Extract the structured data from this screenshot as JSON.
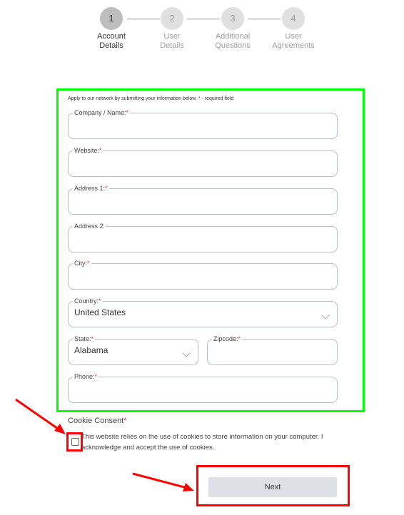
{
  "stepper": {
    "steps": [
      {
        "number": "1",
        "label_line1": "Account",
        "label_line2": "Details",
        "active": true
      },
      {
        "number": "2",
        "label_line1": "User",
        "label_line2": "Details",
        "active": false
      },
      {
        "number": "3",
        "label_line1": "Additional",
        "label_line2": "Questions",
        "active": false
      },
      {
        "number": "4",
        "label_line1": "User",
        "label_line2": "Agreements",
        "active": false
      }
    ]
  },
  "form": {
    "intro": "Apply to our network by submitting your information below. * - required field",
    "required_marker": "*",
    "fields": {
      "company": {
        "label": "Company / Name:",
        "value": "",
        "required": true
      },
      "website": {
        "label": "Website:",
        "value": "",
        "required": true
      },
      "address1": {
        "label": "Address 1:",
        "value": "",
        "required": true
      },
      "address2": {
        "label": "Address 2:",
        "value": "",
        "required": false
      },
      "city": {
        "label": "City:",
        "value": "",
        "required": true
      },
      "country": {
        "label": "Country:",
        "value": "United States",
        "required": true
      },
      "state": {
        "label": "State:",
        "value": "Alabama",
        "required": true
      },
      "zipcode": {
        "label": "Zipcode:",
        "value": "",
        "required": true
      },
      "phone": {
        "label": "Phone:",
        "value": "",
        "required": true
      }
    }
  },
  "cookie": {
    "title": "Cookie Consent",
    "required_marker": "*",
    "text": "This website relies on the use of cookies to store information on your computer. I acknowledge and accept the use of cookies.",
    "checked": false
  },
  "actions": {
    "next_label": "Next"
  },
  "annotations": {
    "highlight_form_color": "#00ff00",
    "highlight_action_color": "#ff0000"
  }
}
